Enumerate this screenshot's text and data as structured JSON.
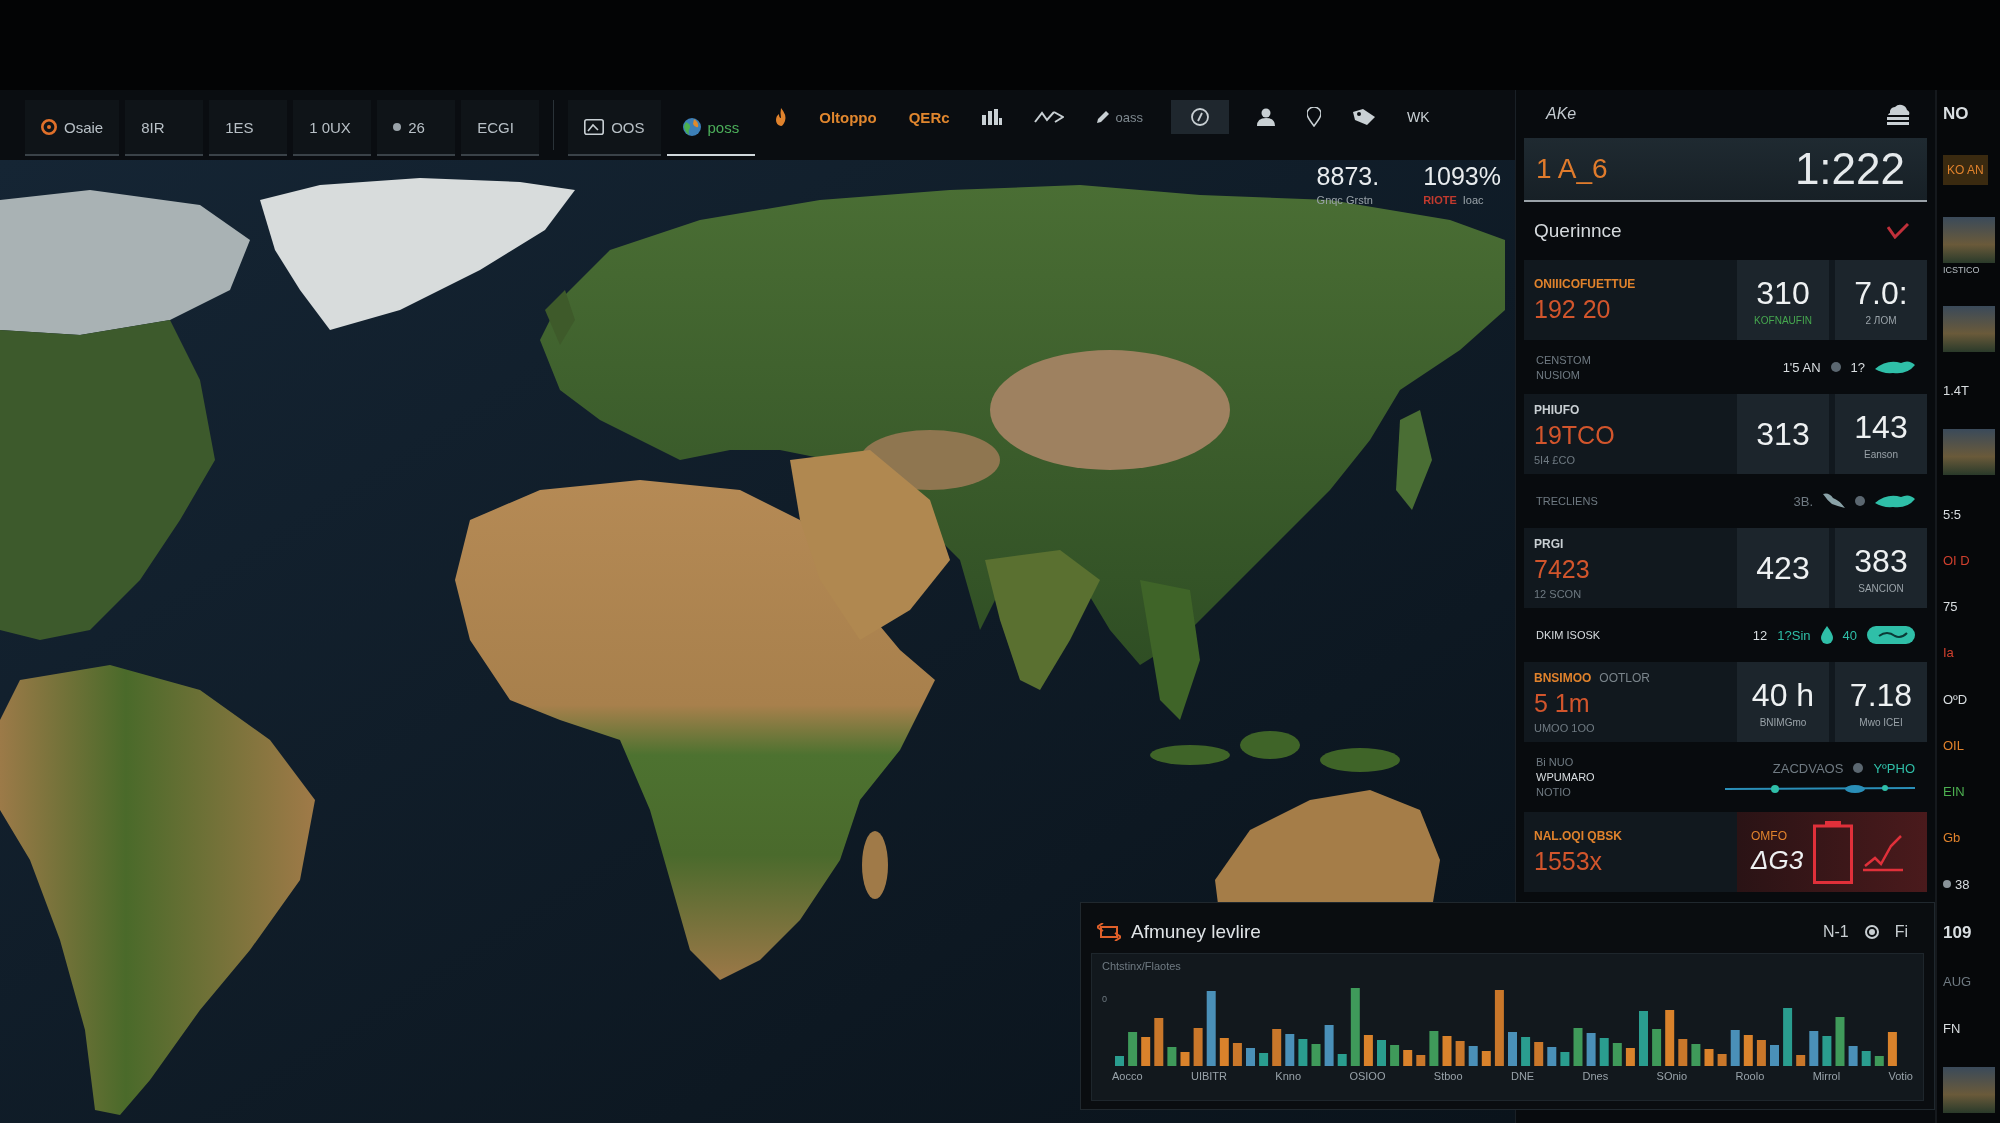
{
  "toolbar": {
    "tabs": [
      {
        "kind": "ring",
        "label": "Osaie",
        "selected": false
      },
      {
        "kind": "plain",
        "label": "8IR",
        "selected": false
      },
      {
        "kind": "plain",
        "label": "1ES",
        "selected": false
      },
      {
        "kind": "plain",
        "label": "1 0UX",
        "selected": false
      },
      {
        "kind": "dot",
        "label": "26",
        "selected": false
      },
      {
        "kind": "plain",
        "label": "ECGI",
        "selected": false
      },
      {
        "kind": "frame",
        "label": "OOS",
        "selected": false
      },
      {
        "kind": "globe",
        "label": "poss",
        "selected": true
      }
    ],
    "tools": [
      {
        "kind": "flame",
        "on": false
      },
      {
        "kind": "warn",
        "label": "Oltoppo",
        "on": false
      },
      {
        "kind": "warn",
        "label": "QERc",
        "on": false
      },
      {
        "kind": "bars",
        "on": false
      },
      {
        "kind": "zigzag",
        "on": false
      },
      {
        "kind": "pen",
        "label": "oass",
        "on": false
      },
      {
        "kind": "circle",
        "on": true
      },
      {
        "kind": "person",
        "on": false
      },
      {
        "kind": "pin",
        "on": false
      },
      {
        "kind": "tag",
        "on": false
      },
      {
        "kind": "text",
        "label": "WK",
        "on": false
      }
    ]
  },
  "map": {
    "stats": [
      {
        "value": "8873.",
        "caption": "Gnqc Grstn"
      },
      {
        "value": "1093%",
        "flag": "RIOTE",
        "caption": "Ioac"
      }
    ]
  },
  "panel": {
    "menu_label": "AKe",
    "header": {
      "code": "1 A_6",
      "time": "1:222"
    },
    "title": "Querinnce",
    "sections": [
      {
        "kind": "card",
        "label": {
          "text": "ONIIICOFUETTUE",
          "kind": "warn"
        },
        "value": "192 20",
        "stats": [
          {
            "value": "310",
            "caption": "KOFNAUFIN",
            "kind": "ok"
          },
          {
            "value": "7.0:",
            "caption": "2 ЛOM",
            "kind": "plain"
          }
        ]
      },
      {
        "kind": "row",
        "lines": [
          {
            "text": "CENSTOM",
            "kind": "muted"
          },
          {
            "text": "NUSIOM",
            "kind": "muted"
          }
        ],
        "readings": [
          {
            "kind": "plain",
            "text": "1'5 AN"
          },
          {
            "kind": "dot"
          },
          {
            "kind": "plain",
            "text": "1?"
          },
          {
            "kind": "leaf"
          }
        ]
      },
      {
        "kind": "card",
        "label": {
          "text": "PHIUFO",
          "kind": "plain"
        },
        "value": "19TCO",
        "sub": "5I4 £CO",
        "stats": [
          {
            "value": "313"
          },
          {
            "value": "143",
            "caption": "Eanson",
            "kind": "plain"
          }
        ]
      },
      {
        "kind": "row",
        "lines": [
          {
            "text": "TRECLIENS",
            "kind": "muted"
          }
        ],
        "readings": [
          {
            "kind": "muted",
            "text": "3B."
          },
          {
            "kind": "bird"
          },
          {
            "kind": "dot"
          },
          {
            "kind": "leaf"
          }
        ]
      },
      {
        "kind": "card",
        "label": {
          "text": "PRGI",
          "kind": "plain"
        },
        "value": "7423",
        "sub": "12 SCON",
        "stats": [
          {
            "value": "423"
          },
          {
            "value": "383",
            "caption": "SANCION",
            "kind": "plain"
          }
        ]
      },
      {
        "kind": "row",
        "lines": [
          {
            "text": "DKIM ISOSK",
            "kind": "plain"
          }
        ],
        "readings": [
          {
            "kind": "plain",
            "text": "12"
          },
          {
            "kind": "teal",
            "text": "1?Sin"
          },
          {
            "kind": "drop"
          },
          {
            "kind": "teal",
            "text": "40"
          },
          {
            "kind": "pill"
          }
        ]
      },
      {
        "kind": "card",
        "label": {
          "text": "BNSIMOO",
          "kind": "warn"
        },
        "label_extra": "OOTLOR",
        "value": "5 1m",
        "sub": "UMOO 1OO",
        "stats": [
          {
            "value": "40 h",
            "caption": "BNIMGmo",
            "kind": "plain"
          },
          {
            "value": "7.18",
            "caption": "Mwo ICEI",
            "kind": "plain"
          }
        ]
      },
      {
        "kind": "row",
        "lines": [
          {
            "text": "Bi NUO",
            "kind": "muted"
          },
          {
            "text": "WPUMARO",
            "kind": "plain"
          },
          {
            "text": "NOTIO",
            "kind": "muted"
          }
        ],
        "readings": [
          {
            "kind": "muted",
            "text": "ZACDVAOS"
          },
          {
            "kind": "dot"
          },
          {
            "kind": "teal",
            "text": "YºPHO"
          }
        ],
        "trace": true
      },
      {
        "kind": "alert",
        "label": {
          "text": "NAL.OQI QBSK",
          "kind": "warn"
        },
        "value": "1553x",
        "alert": {
          "caption": "OMFO",
          "value": "ΔG3"
        }
      }
    ]
  },
  "side_strip": [
    {
      "kind": "heading",
      "text": "NO"
    },
    {
      "kind": "badge",
      "text": "KO AN"
    },
    {
      "kind": "photo",
      "text": "ICSTICO"
    },
    {
      "kind": "photo"
    },
    {
      "kind": "plain",
      "text": "1.4T"
    },
    {
      "kind": "photo"
    },
    {
      "kind": "plain",
      "text": "5:5"
    },
    {
      "kind": "alert",
      "text": "OI D"
    },
    {
      "kind": "plain",
      "text": "75"
    },
    {
      "kind": "alert",
      "text": "Ia"
    },
    {
      "kind": "plain",
      "text": "OºD"
    },
    {
      "kind": "warn",
      "text": "OIL"
    },
    {
      "kind": "ok",
      "text": "EIN"
    },
    {
      "kind": "warn",
      "text": "Gb"
    },
    {
      "kind": "dot",
      "text": "38"
    },
    {
      "kind": "heading",
      "text": "109"
    },
    {
      "kind": "muted",
      "text": "AUG"
    },
    {
      "kind": "plain",
      "text": "FN"
    },
    {
      "kind": "photo"
    }
  ],
  "trend": {
    "title": "Afmuney levlire",
    "controls": [
      "N-1",
      "Fi"
    ],
    "subtitle": "Chtstinx/Flaotes",
    "y_tick": "0",
    "x_labels": [
      "Aocco",
      "UIBITR",
      "Knno",
      "OSIOO",
      "Stboo",
      "DNE",
      "Dnes",
      "SOnio",
      "Roolo",
      "Mirrol",
      "Votio"
    ]
  }
}
